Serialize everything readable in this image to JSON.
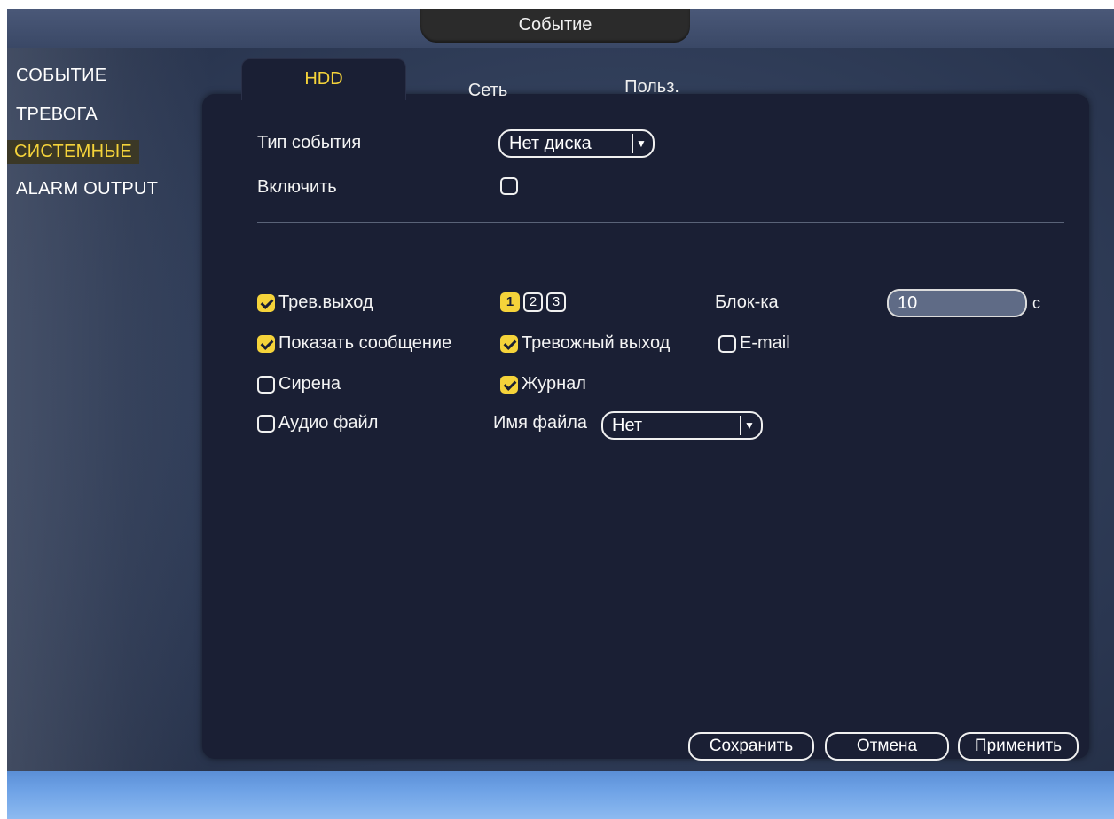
{
  "window": {
    "title": "Событие"
  },
  "sidebar": {
    "items": [
      {
        "label": "СОБЫТИЕ",
        "active": false
      },
      {
        "label": "ТРЕВОГА",
        "active": false
      },
      {
        "label": "СИСТЕМНЫЕ",
        "active": true
      },
      {
        "label": "ALARM OUTPUT",
        "active": false
      }
    ]
  },
  "tabs": [
    {
      "label": "HDD",
      "active": true
    },
    {
      "label": "Сеть",
      "active": false
    },
    {
      "label": "Польз.",
      "active": false
    }
  ],
  "form": {
    "event_type_label": "Тип события",
    "event_type_value": "Нет диска",
    "enable_label": "Включить",
    "enable_checked": false,
    "alarm_out_label": "Трев.выход",
    "alarm_out_checked": true,
    "alarm_channels": [
      "1",
      "2",
      "3"
    ],
    "latch_label": "Блок-ка",
    "latch_value": "10",
    "latch_unit": "с",
    "show_msg_label": "Показать сообщение",
    "show_msg_checked": true,
    "alarm_output_label": "Тревожный выход",
    "alarm_output_checked": true,
    "email_label": "E-mail",
    "email_checked": false,
    "siren_label": "Сирена",
    "siren_checked": false,
    "log_label": "Журнал",
    "log_checked": true,
    "audio_label": "Аудио файл",
    "audio_checked": false,
    "filename_label": "Имя файла",
    "filename_value": "Нет"
  },
  "buttons": {
    "save": "Сохранить",
    "cancel": "Отмена",
    "apply": "Применить"
  },
  "colors": {
    "accent": "#f5d33a",
    "panel": "#1a1f34",
    "background": "#34425e",
    "bottom_bar": "#6ea2e6"
  }
}
